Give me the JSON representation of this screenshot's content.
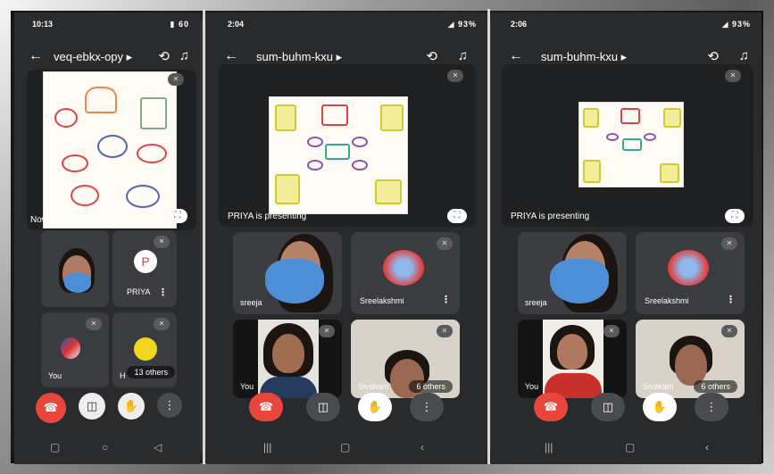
{
  "screens": [
    {
      "status_time": "10:13",
      "status_right": "▮ 60",
      "meeting_code": "veq-ebkx-opy ▸",
      "presenter_label": "Now presenting",
      "tiles": [
        {
          "name": ""
        },
        {
          "name": "PRIYA",
          "initial": "P"
        },
        {
          "name": "You"
        },
        {
          "name": "H",
          "pill": "13 others"
        }
      ]
    },
    {
      "status_time": "2:04",
      "status_right": "◢ 93%",
      "meeting_code": "sum-buhm-kxu ▸",
      "presenter_label": "PRIYA is presenting",
      "tiles": [
        {
          "name": "sreeja"
        },
        {
          "name": "Sreelakshmi"
        },
        {
          "name": "You"
        },
        {
          "name": "Sivakam",
          "pill": "6 others"
        }
      ]
    },
    {
      "status_time": "2:06",
      "status_right": "◢ 93%",
      "meeting_code": "sum-buhm-kxu ▸",
      "presenter_label": "PRIYA is presenting",
      "tiles": [
        {
          "name": "sreeja"
        },
        {
          "name": "Sreelakshmi"
        },
        {
          "name": "You"
        },
        {
          "name": "Sivakam",
          "pill": "6 others"
        }
      ]
    }
  ],
  "icons": {
    "back": "back-arrow-icon",
    "switch_camera": "switch-camera-icon",
    "audio": "audio-icon",
    "mic_off": "mic-off-icon",
    "fullscreen": "fullscreen-icon",
    "more": "more-vert-icon",
    "end_call": "end-call-icon",
    "video": "video-icon",
    "hand": "raise-hand-icon"
  },
  "colors": {
    "end_call": "#e8453c",
    "screen_bg": "#2b2c2e",
    "tile_bg": "#3b3c3f",
    "mask": "#4c8fd6"
  }
}
